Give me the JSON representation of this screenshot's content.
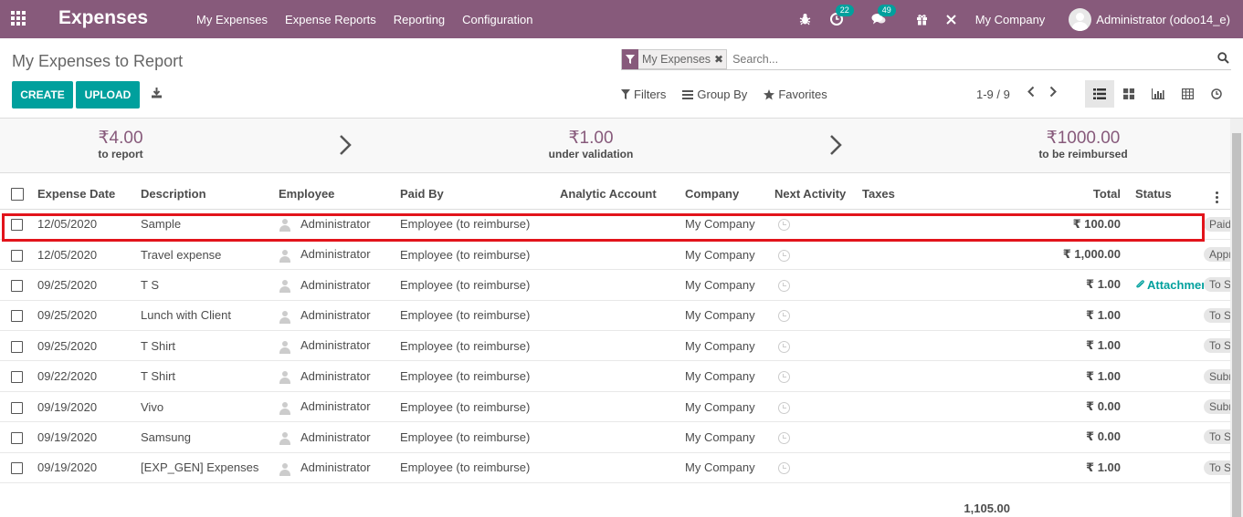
{
  "navbar": {
    "app_title": "Expenses",
    "menu": [
      "My Expenses",
      "Expense Reports",
      "Reporting",
      "Configuration"
    ],
    "activity_count": "22",
    "messages_count": "49",
    "company": "My Company",
    "user": "Administrator (odoo14_e)",
    "color": "#875a7b"
  },
  "control_panel": {
    "breadcrumb": "My Expenses to Report",
    "create_label": "CREATE",
    "upload_label": "UPLOAD",
    "facet_label": "My Expenses",
    "search_placeholder": "Search...",
    "filters_label": "Filters",
    "group_by_label": "Group By",
    "favorites_label": "Favorites",
    "pager": "1-9 / 9",
    "accent_color": "#00a09d"
  },
  "dashboard": {
    "to_report_amount": "₹4.00",
    "to_report_label": "to report",
    "under_validation_amount": "₹1.00",
    "under_validation_label": "under validation",
    "to_be_reimbursed_amount": "₹1000.00",
    "to_be_reimbursed_label": "to be reimbursed"
  },
  "table": {
    "headers": {
      "date": "Expense Date",
      "description": "Description",
      "employee": "Employee",
      "paid_by": "Paid By",
      "analytic": "Analytic Account",
      "company": "Company",
      "activity": "Next Activity",
      "taxes": "Taxes",
      "total": "Total",
      "status": "Status"
    },
    "rows": [
      {
        "date": "12/05/2020",
        "description": "Sample",
        "employee": "Administrator",
        "paid_by": "Employee (to reimburse)",
        "company": "My Company",
        "total": "₹ 100.00",
        "attachment": "",
        "status": "Paid"
      },
      {
        "date": "12/05/2020",
        "description": "Travel expense",
        "employee": "Administrator",
        "paid_by": "Employee (to reimburse)",
        "company": "My Company",
        "total": "₹ 1,000.00",
        "attachment": "",
        "status": "Approved"
      },
      {
        "date": "09/25/2020",
        "description": "T S",
        "employee": "Administrator",
        "paid_by": "Employee (to reimburse)",
        "company": "My Company",
        "total": "₹ 1.00",
        "attachment": "Attachments",
        "status": "To Submit"
      },
      {
        "date": "09/25/2020",
        "description": "Lunch with Client",
        "employee": "Administrator",
        "paid_by": "Employee (to reimburse)",
        "company": "My Company",
        "total": "₹ 1.00",
        "attachment": "",
        "status": "To Submit"
      },
      {
        "date": "09/25/2020",
        "description": "T Shirt",
        "employee": "Administrator",
        "paid_by": "Employee (to reimburse)",
        "company": "My Company",
        "total": "₹ 1.00",
        "attachment": "",
        "status": "To Submit"
      },
      {
        "date": "09/22/2020",
        "description": "T Shirt",
        "employee": "Administrator",
        "paid_by": "Employee (to reimburse)",
        "company": "My Company",
        "total": "₹ 1.00",
        "attachment": "",
        "status": "Submitted"
      },
      {
        "date": "09/19/2020",
        "description": "Vivo",
        "employee": "Administrator",
        "paid_by": "Employee (to reimburse)",
        "company": "My Company",
        "total": "₹ 0.00",
        "attachment": "",
        "status": "Submitted"
      },
      {
        "date": "09/19/2020",
        "description": "Samsung",
        "employee": "Administrator",
        "paid_by": "Employee (to reimburse)",
        "company": "My Company",
        "total": "₹ 0.00",
        "attachment": "",
        "status": "To Submit"
      },
      {
        "date": "09/19/2020",
        "description": "[EXP_GEN] Expenses",
        "employee": "Administrator",
        "paid_by": "Employee (to reimburse)",
        "company": "My Company",
        "total": "₹ 1.00",
        "attachment": "",
        "status": "To Submit"
      }
    ],
    "grand_total": "1,105.00"
  }
}
